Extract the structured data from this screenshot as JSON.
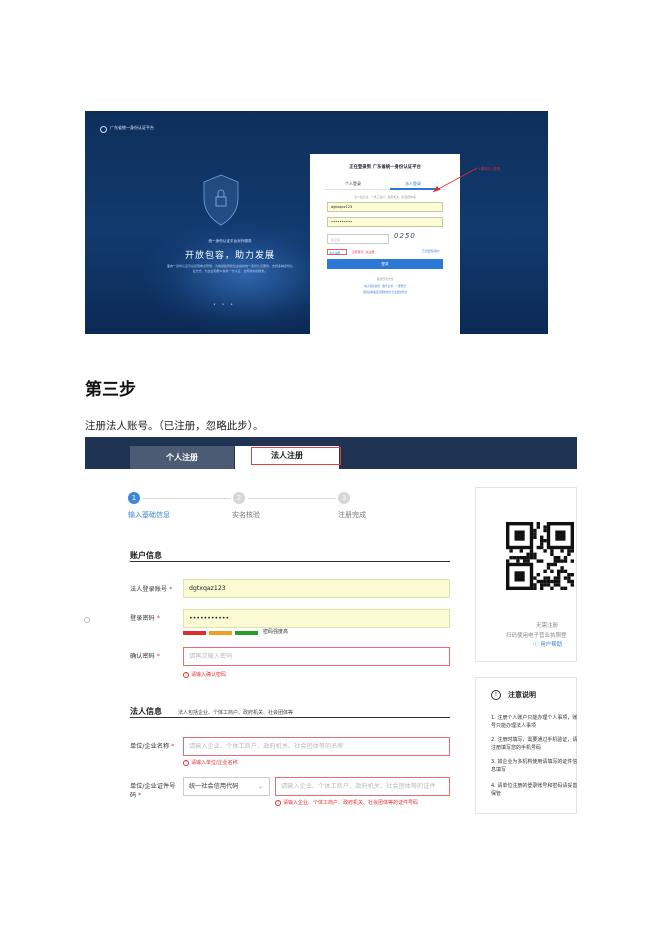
{
  "screenshot1": {
    "platform_name": "广东省统一身份认证平台",
    "slogan_small": "统一身份认证平台对外服务",
    "slogan_big": "开放包容，助力发展",
    "description": "面向一身份认证平台实现单点登录，为各级政府和企业提供统一身份认证服务，支持多种身份认证方式，为企业和群众提供一次认证，全网通办的服务。",
    "login": {
      "title": "正在登录到 广东省统一身份认证平台",
      "tab_personal": "个人登录",
      "tab_legal": "法人登录",
      "hint": "法人指企业、个体工商户、政府机关、社会团体等",
      "username": "dgtxqaz123",
      "password": "••••••••••",
      "code_placeholder": "验证码",
      "captcha": "0250",
      "register": "法人注册",
      "register_note": "没有账号，先注册",
      "forgot": "忘记密码/用户",
      "login_button": "登录",
      "other_methods": "其他登录方式",
      "other_links": "电子营业执照　数字证书　一键登录",
      "other_links2": "通过其他渠道注册的用户点击此处登录"
    },
    "annotation": "1.跳转法人登录"
  },
  "heading": "第三步",
  "paragraph": "注册法人账号。（已注册，忽略此步）。",
  "screenshot2": {
    "tabs": {
      "personal": "个人注册",
      "legal": "法人注册"
    },
    "steps": [
      {
        "num": "1",
        "label": "输入基础信息"
      },
      {
        "num": "2",
        "label": "实名核验"
      },
      {
        "num": "3",
        "label": "注册完成"
      }
    ],
    "account_section": "账户信息",
    "fields": {
      "login_account_label": "法人登录账号",
      "login_account_value": "dgtxqaz123",
      "password_label": "登录密码",
      "password_value": "•••••••••••",
      "strength_label": "密码强度高",
      "confirm_label": "确认密码",
      "confirm_placeholder": "请再次输入密码",
      "confirm_error": "请输入确认密码"
    },
    "legal_section": "法人信息",
    "legal_section_sub": "法人包括企业、个体工商户、政府机关、社会团体等",
    "org_name_label": "单位/企业名称",
    "org_name_placeholder": "请输入企业、个体工商户、政府机关、社会团体等的名称",
    "org_name_error": "请输入单位/企业名称",
    "org_id_label_1": "单位/企业证件号",
    "org_id_label_2": "码",
    "org_id_type": "统一社会信用代码",
    "org_id_placeholder": "请输入企业、个体工商户、政府机关、社会团体等的证件",
    "org_id_error": "请输入企业、个体工商户、政府机关、社会团体等的证件号码",
    "side": {
      "tip1": "无需注册",
      "tip2": "扫码使用电子营业执照登",
      "help": "ⓘ 用户帮助",
      "note_title": "注意说明",
      "notes": [
        "1. 注册个人账户只能办理个人事项，账号只能办理法人事项",
        "2. 注册时填写，需要通过手机验证，请注册填写您的手机号码",
        "3. 如企业为多机构使用请填写的证件信息填写",
        "4. 请单位注册的登录账号和密码请妥善保管"
      ]
    }
  }
}
